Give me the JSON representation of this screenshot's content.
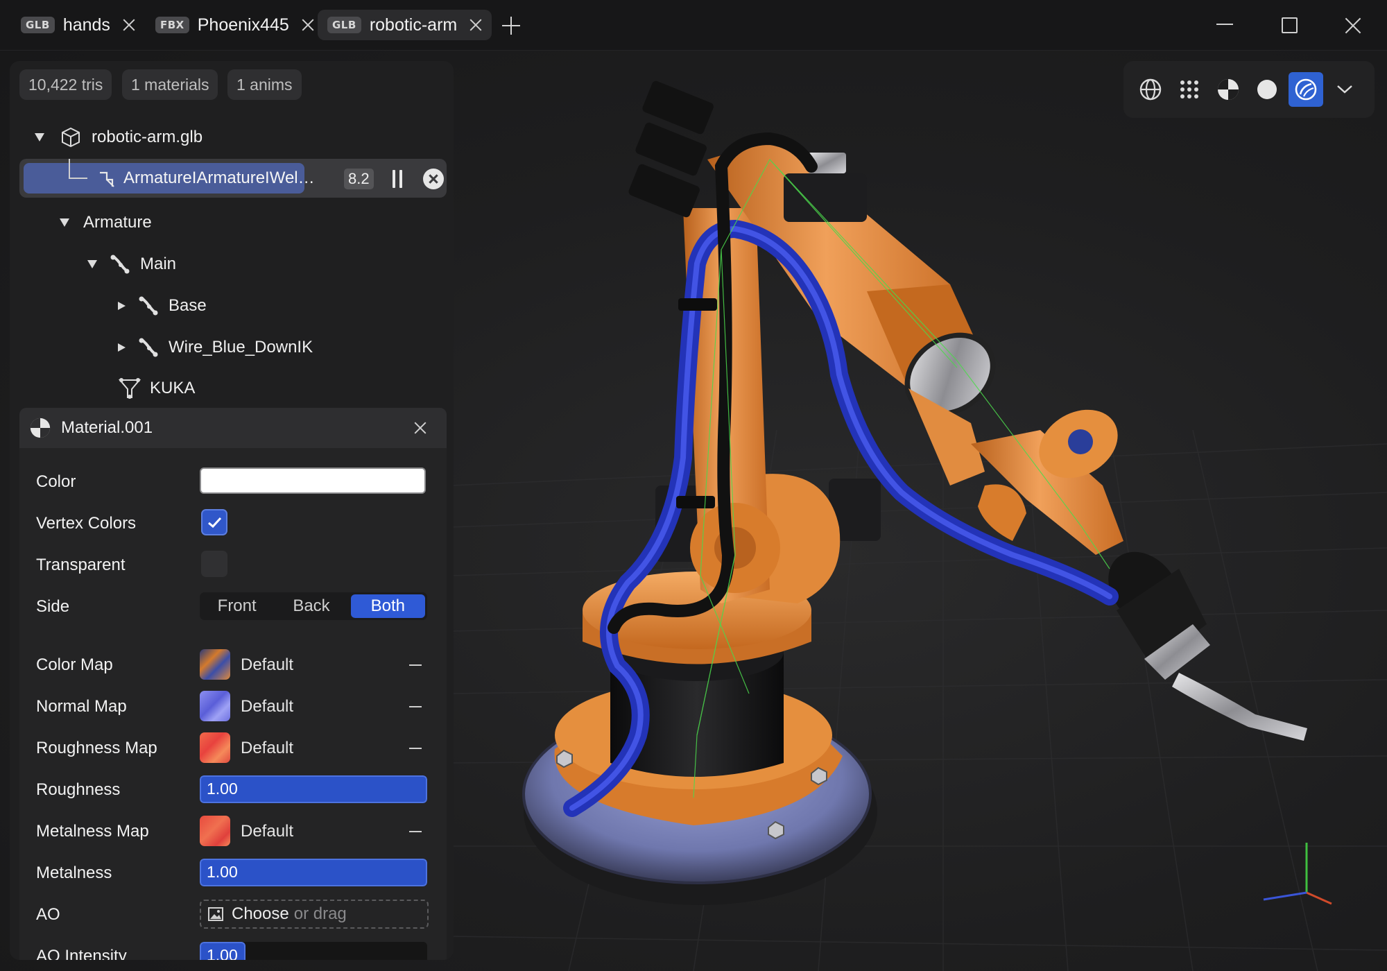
{
  "tabs": [
    {
      "format": "GLB",
      "name": "hands"
    },
    {
      "format": "FBX",
      "name": "Phoenix445"
    },
    {
      "format": "GLB",
      "name": "robotic-arm",
      "active": true
    }
  ],
  "stats": {
    "tris": "10,422 tris",
    "materials": "1 materials",
    "anims": "1 anims"
  },
  "tree": {
    "root": "robotic-arm.glb",
    "animation": {
      "name": "ArmatureIArmatureIWel…",
      "time": "8.2",
      "progress": 0.67
    },
    "nodes": {
      "armature": "Armature",
      "main": "Main",
      "base": "Base",
      "wire": "Wire_Blue_DownIK",
      "kuka": "KUKA"
    }
  },
  "material": {
    "title": "Material.001",
    "color_label": "Color",
    "color_value": "#ffffff",
    "vertex_colors_label": "Vertex Colors",
    "vertex_colors": true,
    "transparent_label": "Transparent",
    "transparent": false,
    "side_label": "Side",
    "side_options": [
      "Front",
      "Back",
      "Both"
    ],
    "side_selected": "Both",
    "color_map_label": "Color Map",
    "color_map_value": "Default",
    "normal_map_label": "Normal Map",
    "normal_map_value": "Default",
    "roughness_map_label": "Roughness Map",
    "roughness_map_value": "Default",
    "roughness_label": "Roughness",
    "roughness_value": "1.00",
    "metalness_map_label": "Metalness Map",
    "metalness_map_value": "Default",
    "metalness_label": "Metalness",
    "metalness_value": "1.00",
    "ao_label": "AO",
    "ao_choose": "Choose",
    "ao_drag": "or drag",
    "ao_intensity_label": "AO Intensity",
    "ao_intensity_value": "1.00"
  },
  "viewport_tools": [
    "globe-icon",
    "grid-icon",
    "material-icon",
    "solid-sphere-icon",
    "env-sphere-icon",
    "chevron-down-icon"
  ],
  "viewport_tool_selected": "env-sphere-icon",
  "colors": {
    "accent": "#2f5ad6",
    "robot_orange": "#d9802f",
    "cable_blue": "#2b3fd0",
    "base_plate": "#7b83b8"
  }
}
